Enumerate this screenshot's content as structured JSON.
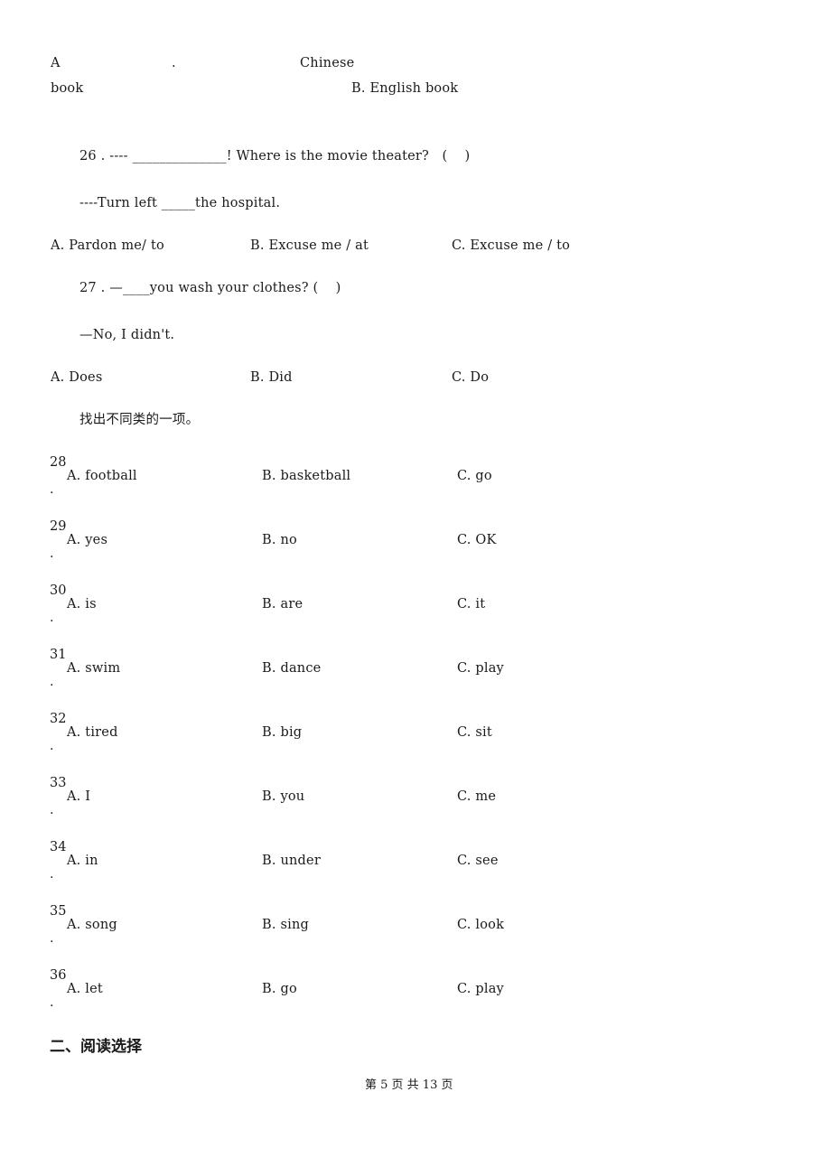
{
  "q25_options": {
    "a_label": "A",
    "a_dot": ".",
    "a_word": "Chinese",
    "a_cont": "book",
    "b": "B. English book"
  },
  "q26": {
    "stem": "26 . ---- ______________! Where is the movie theater?   (    )",
    "reply": "----Turn left _____the hospital.",
    "options": [
      "A. Pardon me/ to",
      "B. Excuse me / at",
      "C. Excuse me / to"
    ]
  },
  "q27": {
    "stem": "27 . —____you wash your clothes? (    )",
    "reply": "—No, I didn't.",
    "options": [
      "A. Does",
      "B. Did",
      "C. Do"
    ]
  },
  "instruction": "找出不同类的一项。",
  "odd_one_out": [
    {
      "num": "28",
      "dot": ".",
      "options": [
        "A. football",
        "B. basketball",
        "C. go"
      ]
    },
    {
      "num": "29",
      "dot": ".",
      "options": [
        "A. yes",
        "B. no",
        "C. OK"
      ]
    },
    {
      "num": "30",
      "dot": ".",
      "options": [
        "A. is",
        "B. are",
        "C. it"
      ]
    },
    {
      "num": "31",
      "dot": ".",
      "options": [
        "A. swim",
        "B. dance",
        "C. play"
      ]
    },
    {
      "num": "32",
      "dot": ".",
      "options": [
        "A. tired",
        "B. big",
        "C. sit"
      ]
    },
    {
      "num": "33",
      "dot": ".",
      "options": [
        "A. I",
        "B. you",
        "C. me"
      ]
    },
    {
      "num": "34",
      "dot": ".",
      "options": [
        "A. in",
        "B. under",
        "C. see"
      ]
    },
    {
      "num": "35",
      "dot": ".",
      "options": [
        "A. song",
        "B. sing",
        "C. look"
      ]
    },
    {
      "num": "36",
      "dot": ".",
      "options": [
        "A. let",
        "B. go",
        "C. play"
      ]
    }
  ],
  "section_heading": "二、阅读选择",
  "footer": "第 5 页 共 13 页"
}
